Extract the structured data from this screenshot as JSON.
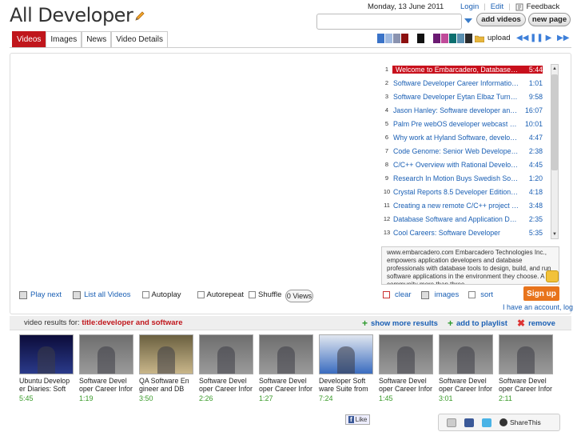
{
  "header": {
    "logo": "All Developer",
    "date": "Monday, 13 June 2011",
    "links": [
      "Login",
      "Edit",
      "Feedback"
    ],
    "search_placeholder": "",
    "add_videos": "add videos",
    "new_page": "new page"
  },
  "tabs": [
    "Videos",
    "Images",
    "News",
    "Video Details"
  ],
  "toolbar": {
    "swatches": [
      "#3a73c8",
      "#9fb9e0",
      "#8a93b0",
      "#8c1010",
      "#ffffff",
      "#111111",
      "#ffffff",
      "#6b1a72",
      "#c04b9a",
      "#0d6f6f",
      "#5a8fb0",
      "#2b2b2b"
    ],
    "upload": "upload"
  },
  "playlist": [
    {
      "num": "1",
      "title": "Welcome to Embarcadero, Database Tc...",
      "dur": "5:44"
    },
    {
      "num": "2",
      "title": "Software Developer Career Information ...",
      "dur": "1:01"
    },
    {
      "num": "3",
      "title": "Software Developer Eytan Elbaz Turns I...",
      "dur": "9:58"
    },
    {
      "num": "4",
      "title": "Jason Hanley: Software developer and ...",
      "dur": "16:07"
    },
    {
      "num": "5",
      "title": "Palm Pre webOS developer webcast - P...",
      "dur": "10:01"
    },
    {
      "num": "6",
      "title": "Why work at Hyland Software, develope...",
      "dur": "4:47"
    },
    {
      "num": "7",
      "title": "Code Genome: Senior Web Developer ...",
      "dur": "2:38"
    },
    {
      "num": "8",
      "title": "C/C++ Overview with Rational Develope...",
      "dur": "4:45"
    },
    {
      "num": "9",
      "title": "Research In Motion Buys Swedish Softw...",
      "dur": "1:20"
    },
    {
      "num": "10",
      "title": "Crystal Reports 8.5 Developer Edition F...",
      "dur": "4:18"
    },
    {
      "num": "11",
      "title": "Creating a new remote C/C++ project w...",
      "dur": "3:48"
    },
    {
      "num": "12",
      "title": "Database Software and Application Dev...",
      "dur": "2:35"
    },
    {
      "num": "13",
      "title": "Cool Careers: Software Developer",
      "dur": "5:35"
    }
  ],
  "description": "www.embarcadero.com Embarcadero Technologies Inc., empowers application developers and database professionals with database tools to design, build, and run software applications in the environment they choose. A community more than three",
  "signup": "Sign up",
  "account": "I have an account, log",
  "controls": {
    "play_next": "Play next",
    "list_all": "List all Videos",
    "autoplay": "Autoplay",
    "autorepeat": "Autorepeat",
    "shuffle": "Shuffle",
    "views": "0 Views",
    "clear": "clear",
    "images": "images",
    "sort": "sort"
  },
  "results": {
    "label": "video results for:",
    "query": "title:developer and software",
    "show_more": "show more results",
    "add_playlist": "add to playlist",
    "remove": "remove"
  },
  "thumbs": [
    {
      "title": "Ubuntu Develop er Diaries: Soft",
      "dur": "5:45"
    },
    {
      "title": "Software Devel oper Career Infor",
      "dur": "1:19"
    },
    {
      "title": "QA Software En gineer and DB",
      "dur": "3:50"
    },
    {
      "title": "Software Devel oper Career Infor",
      "dur": "2:26"
    },
    {
      "title": "Software Devel oper Career Infor",
      "dur": "1:27"
    },
    {
      "title": "Developer Soft ware Suite from",
      "dur": "7:24"
    },
    {
      "title": "Software Devel oper Career Infor",
      "dur": "1:45"
    },
    {
      "title": "Software Devel oper Career Infor",
      "dur": "3:01"
    },
    {
      "title": "Software Devel oper Career Infor",
      "dur": "2:11"
    }
  ],
  "footer": {
    "like": "Like",
    "sharethis": "ShareThis"
  }
}
